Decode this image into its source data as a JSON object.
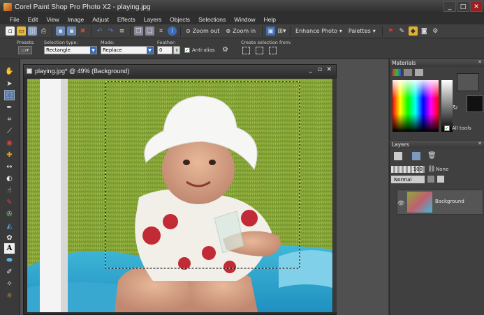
{
  "window": {
    "title": "Corel Paint Shop Pro Photo X2 - playing.jpg"
  },
  "menu": [
    "File",
    "Edit",
    "View",
    "Image",
    "Adjust",
    "Effects",
    "Layers",
    "Objects",
    "Selections",
    "Window",
    "Help"
  ],
  "toolbar": {
    "zoom_out": "Zoom out",
    "zoom_in": "Zoom in",
    "enhance_photo": "Enhance Photo",
    "palettes": "Palettes"
  },
  "options": {
    "presets_label": "Presets:",
    "selection_type_label": "Selection type:",
    "selection_type": "Rectangle",
    "mode_label": "Mode:",
    "mode": "Replace",
    "feather_label": "Feather:",
    "feather": "0",
    "antialias": "Anti-alias",
    "create_from_label": "Create selection from:"
  },
  "document": {
    "title": "playing.jpg* @ 49% (Background)"
  },
  "materials": {
    "title": "Materials",
    "all_tools": "All tools"
  },
  "layers": {
    "title": "Layers",
    "opacity": "100",
    "link": "None",
    "blend": "Normal",
    "layer_name": "Background"
  },
  "colors": {
    "accent": "#3a6db8",
    "panel": "#3f3f3f",
    "selection_ant": "#ffffff"
  }
}
